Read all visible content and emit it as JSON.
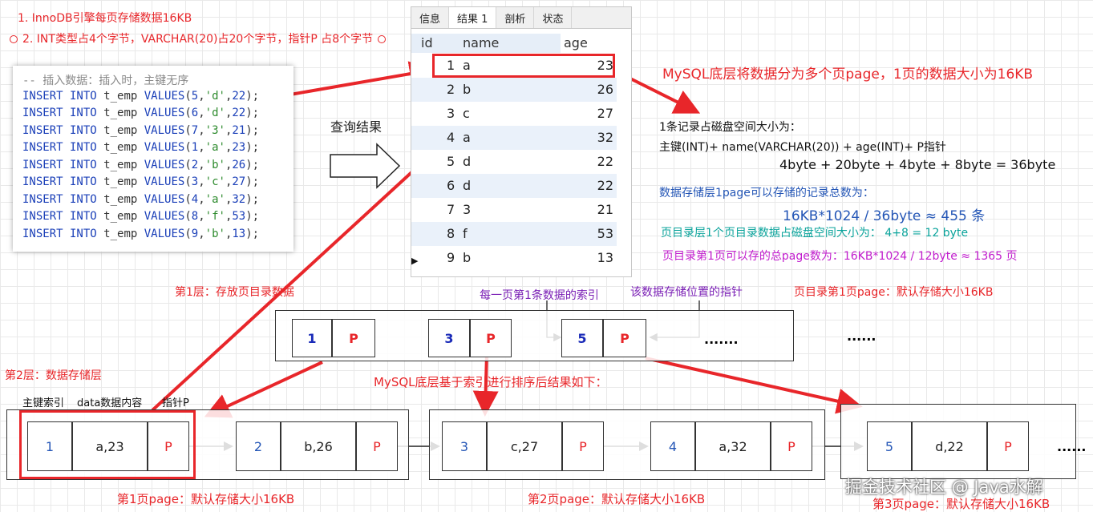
{
  "notes": {
    "line1": "1. InnoDB引擎每页存储数据16KB",
    "line2": "2. INT类型占4个字节，VARCHAR(20)占20个字节，指针P 占8个字节"
  },
  "sql": {
    "comment": "-- 插入数据：插入时，主键无序",
    "keyword": "INSERT INTO",
    "table": "t_emp",
    "values_kw": "VALUES",
    "rows": [
      {
        "id": "5",
        "name": "'d'",
        "age": "22"
      },
      {
        "id": "6",
        "name": "'d'",
        "age": "22"
      },
      {
        "id": "7",
        "name": "'3'",
        "age": "21"
      },
      {
        "id": "1",
        "name": "'a'",
        "age": "23"
      },
      {
        "id": "2",
        "name": "'b'",
        "age": "26"
      },
      {
        "id": "3",
        "name": "'c'",
        "age": "27"
      },
      {
        "id": "4",
        "name": "'a'",
        "age": "32"
      },
      {
        "id": "8",
        "name": "'f'",
        "age": "53"
      },
      {
        "id": "9",
        "name": "'b'",
        "age": "13"
      }
    ]
  },
  "query_label": "查询结果",
  "result": {
    "tabs": [
      "信息",
      "结果 1",
      "剖析",
      "状态"
    ],
    "columns": [
      "id",
      "name",
      "age"
    ],
    "rows": [
      {
        "id": "1",
        "name": "a",
        "age": "23"
      },
      {
        "id": "2",
        "name": "b",
        "age": "26"
      },
      {
        "id": "3",
        "name": "c",
        "age": "27"
      },
      {
        "id": "4",
        "name": "a",
        "age": "32"
      },
      {
        "id": "5",
        "name": "d",
        "age": "22"
      },
      {
        "id": "6",
        "name": "d",
        "age": "22"
      },
      {
        "id": "7",
        "name": "3",
        "age": "21"
      },
      {
        "id": "8",
        "name": "f",
        "age": "53"
      },
      {
        "id": "9",
        "name": "b",
        "age": "13"
      }
    ]
  },
  "right": {
    "title": "MySQL底层将数据分为多个页page，1页的数据大小为16KB",
    "rec_title": "1条记录占磁盘空间大小为：",
    "rec_formula": "主键(INT)+ name(VARCHAR(20)) + age(INT)+ P指针",
    "rec_bytes": "4byte + 20byte + 4byte + 8byte = 36byte",
    "page_title": "数据存储层1page可以存储的记录总数为：",
    "page_calc": "16KB*1024 / 36byte ≈ 455 条",
    "dir_size": "页目录层1个页目录数据占磁盘空间大小为：  4+8 = 12 byte",
    "dir_count": "页目录第1页可以存的总page数为：16KB*1024 / 12byte  ≈ 1365 页"
  },
  "layer1": {
    "label": "第1层：存放页目录数据",
    "index_note": "每一页第1条数据的索引",
    "pointer_note": "该数据存储位置的指针",
    "page_note": "页目录第1页page：默认存储大小16KB",
    "entries": [
      {
        "key": "1",
        "ptr": "P"
      },
      {
        "key": "3",
        "ptr": "P"
      },
      {
        "key": "5",
        "ptr": "P"
      }
    ],
    "ellipsis_in": ".......",
    "ellipsis_out": "......"
  },
  "layer2": {
    "label": "第2层：数据存储层",
    "sort_note": "MySQL底层基于索引进行排序后结果如下：",
    "hdr_pk": "主键索引",
    "hdr_data": "data数据内容",
    "hdr_ptr": "指针P",
    "records": [
      {
        "key": "1",
        "data": "a,23",
        "ptr": "P"
      },
      {
        "key": "2",
        "data": "b,26",
        "ptr": "P"
      },
      {
        "key": "3",
        "data": "c,27",
        "ptr": "P"
      },
      {
        "key": "4",
        "data": "a,32",
        "ptr": "P"
      },
      {
        "key": "5",
        "data": "d,22",
        "ptr": "P"
      }
    ],
    "page1": "第1页page：默认存储大小16KB",
    "page2": "第2页page：默认存储大小16KB",
    "page3": "第3页page：默认存储大小16KB",
    "ellipsis": "......"
  },
  "watermark": "掘金技术社区 @ Java水解",
  "colors": {
    "accent_red": "#e8262a",
    "blue": "#2456b6",
    "teal": "#0aa39b",
    "magenta": "#c11ccd",
    "purple": "#7a1fb5"
  }
}
